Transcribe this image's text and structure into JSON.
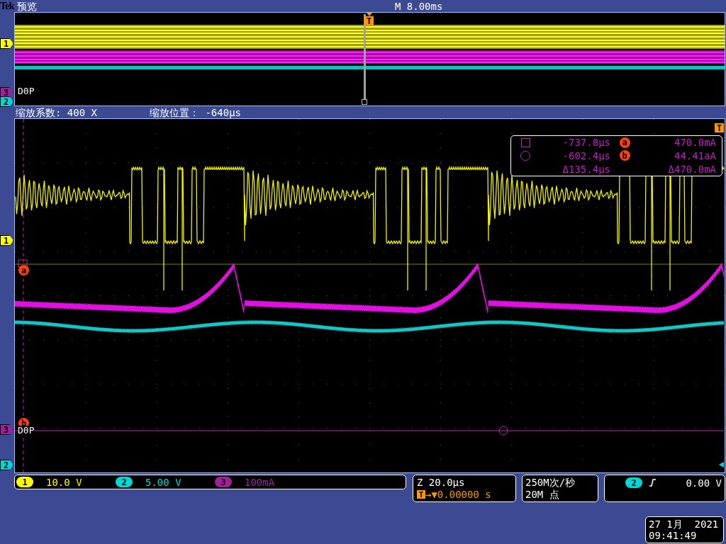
{
  "header": {
    "brand": "Tek",
    "title": "预览",
    "timebase": "M 8.00ms"
  },
  "overview": {
    "trigger_label": "T",
    "digital_label": "D0P",
    "markers": [
      {
        "label": "1",
        "color": "#ffff00"
      },
      {
        "label": "3",
        "color": "#a020a0"
      },
      {
        "label": "2",
        "color": "#00d8d8"
      }
    ]
  },
  "zoom_info": {
    "factor": "缩放系数: 400 X",
    "position": "缩放位置： -640µs"
  },
  "plot": {
    "trigger_label": "T",
    "digital_label": "D0P",
    "cursor_labels": [
      "a",
      "b"
    ],
    "markers": [
      {
        "label": "1",
        "color": "#ffff00"
      },
      {
        "label": "3",
        "color": "#a020a0"
      },
      {
        "label": "2",
        "color": "#00d8d8"
      }
    ]
  },
  "cursor_readout": {
    "rows": [
      {
        "kind": "square",
        "time": "-737.8µs",
        "cursor": "a",
        "value": "470.0mA"
      },
      {
        "kind": "circle",
        "time": "-602.4µs",
        "cursor": "b",
        "value": "44.41aA"
      }
    ],
    "delta_time": "Δ135.4µs",
    "delta_value": "Δ470.0mA"
  },
  "channels": [
    {
      "number": "1",
      "scale": "10.0 V",
      "color": "#ffff00"
    },
    {
      "number": "2",
      "scale": "5.00 V",
      "color": "#00d8d8"
    },
    {
      "number": "3",
      "scale": "100mA",
      "color": "#a020a0"
    }
  ],
  "horizontal": {
    "zoom": "Z 20.0µs",
    "trigger_label": "T",
    "delay": "→▼0.00000 s"
  },
  "acquisition": {
    "rate": "250M次/秒",
    "points": "20M 点"
  },
  "trigger": {
    "channel": "2",
    "level": "0.00 V"
  },
  "datetime": {
    "date": "27 1月  2021",
    "time": "09:41:49"
  }
}
